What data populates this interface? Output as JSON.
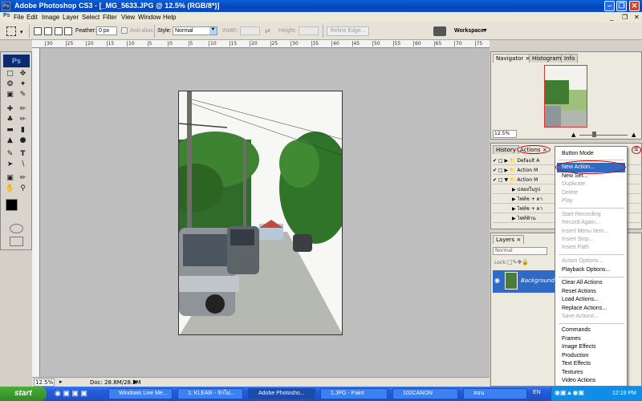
{
  "window": {
    "title": "Adobe Photoshop CS3 - [_MG_5633.JPG @ 12.5% (RGB/8*)]",
    "icon": "Ps"
  },
  "menubar": [
    "File",
    "Edit",
    "Image",
    "Layer",
    "Select",
    "Filter",
    "View",
    "Window",
    "Help"
  ],
  "options": {
    "feather_label": "Feather:",
    "feather_value": "0 px",
    "antialias_label": "Anti-alias",
    "style_label": "Style:",
    "style_value": "Normal",
    "width_label": "Width:",
    "height_label": "Height:",
    "refine_edge": "Refine Edge...",
    "workspace": "Workspace"
  },
  "toolbox": {
    "logo": "Ps"
  },
  "ruler": {
    "ticks": [
      "30",
      "25",
      "20",
      "15",
      "10",
      "5",
      "0",
      "5",
      "10",
      "15",
      "20",
      "25",
      "30",
      "35",
      "40",
      "45",
      "50",
      "55",
      "60",
      "65",
      "70",
      "75"
    ]
  },
  "status": {
    "zoom": "12.5%",
    "doc": "Doc: 28.8M/28.8M"
  },
  "navigator": {
    "tabs": [
      "Navigator",
      "Histogram",
      "Info"
    ],
    "zoom": "12.5%"
  },
  "actions": {
    "tabs": [
      "History",
      "Actions"
    ],
    "rows": [
      "Default A",
      "Action M",
      "Action M",
      "ปล่อยในรูป",
      "ไฟท์ช + ดา",
      "ไฟท์ช + ดา",
      "ไฟท์ฟ้าน"
    ]
  },
  "layers": {
    "tabs": [
      "Layers"
    ],
    "blend": "Normal",
    "lock_label": "Lock:",
    "layer_name": "Background"
  },
  "flyout": {
    "items": [
      {
        "label": "Button Mode",
        "enabled": true
      },
      {
        "label": "New Action...",
        "enabled": true,
        "selected": true
      },
      {
        "label": "New Set...",
        "enabled": true
      },
      {
        "label": "Duplicate",
        "enabled": false
      },
      {
        "label": "Delete",
        "enabled": false
      },
      {
        "label": "Play",
        "enabled": false
      },
      {
        "label": "Start Recording",
        "enabled": false
      },
      {
        "label": "Record Again...",
        "enabled": false
      },
      {
        "label": "Insert Menu Item...",
        "enabled": false
      },
      {
        "label": "Insert Stop...",
        "enabled": false
      },
      {
        "label": "Insert Path",
        "enabled": false
      },
      {
        "label": "Action Options...",
        "enabled": false
      },
      {
        "label": "Playback Options...",
        "enabled": true
      },
      {
        "label": "Clear All Actions",
        "enabled": true
      },
      {
        "label": "Reset Actions",
        "enabled": true
      },
      {
        "label": "Load Actions...",
        "enabled": true
      },
      {
        "label": "Replace Actions...",
        "enabled": true
      },
      {
        "label": "Save Actions...",
        "enabled": false
      },
      {
        "label": "Commands",
        "enabled": true
      },
      {
        "label": "Frames",
        "enabled": true
      },
      {
        "label": "Image Effects",
        "enabled": true
      },
      {
        "label": "Production",
        "enabled": true
      },
      {
        "label": "Text Effects",
        "enabled": true
      },
      {
        "label": "Textures",
        "enabled": true
      },
      {
        "label": "Video Actions",
        "enabled": true
      }
    ]
  },
  "taskbar": {
    "start": "start",
    "buttons": [
      "Windows Live Me...",
      "1: KLEAR - รักไม่...",
      "Adobe Photosho...",
      "1.JPG - Paint",
      "102CANON",
      "สอน"
    ],
    "lang": "EN",
    "clock": "12:19 PM"
  },
  "colors": {
    "selection": "#316ac5",
    "annotation": "#cc0000",
    "titlebar": "#0645b7"
  }
}
